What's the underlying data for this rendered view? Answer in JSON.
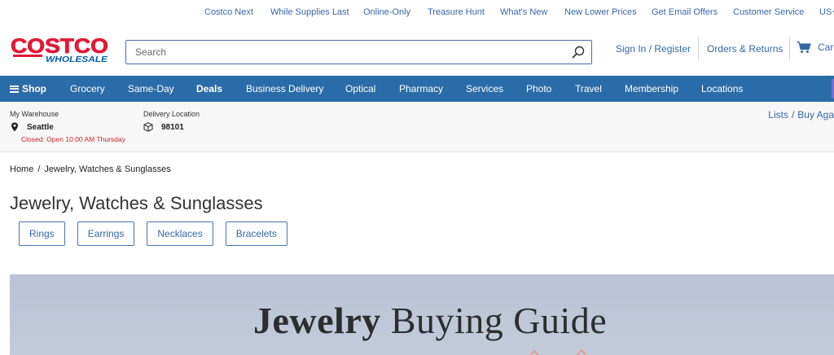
{
  "utility": {
    "links": [
      "Costco Next",
      "While Supplies Last",
      "Online-Only",
      "Treasure Hunt",
      "What's New",
      "New Lower Prices",
      "Get Email Offers",
      "Customer Service"
    ],
    "country": "US"
  },
  "header": {
    "logo_primary": "COSTCO",
    "logo_secondary": "WHOLESALE",
    "search_placeholder": "Search",
    "sign_in": "Sign In / Register",
    "orders": "Orders & Returns",
    "cart": "Car"
  },
  "nav": {
    "shop": "Shop",
    "items": [
      "Grocery",
      "Same-Day",
      "Deals",
      "Business Delivery",
      "Optical",
      "Pharmacy",
      "Services",
      "Photo",
      "Travel",
      "Membership",
      "Locations"
    ]
  },
  "location": {
    "warehouse_label": "My Warehouse",
    "warehouse_value": "Seattle",
    "warehouse_status": "Closed: Open 10:00 AM Thursday",
    "delivery_label": "Delivery Location",
    "delivery_value": "98101",
    "lists": "Lists",
    "separator": "/",
    "buy_again": "Buy Aga"
  },
  "breadcrumb": {
    "home": "Home",
    "separator": "/",
    "current": "Jewelry, Watches & Sunglasses"
  },
  "page": {
    "title": "Jewelry, Watches & Sunglasses"
  },
  "chips": [
    "Rings",
    "Earrings",
    "Necklaces",
    "Bracelets"
  ],
  "banner": {
    "title_strong": "Jewelry",
    "title_rest": " Buying Guide"
  },
  "colors": {
    "brand_red": "#e31837",
    "brand_blue": "#005daa",
    "link_blue": "#3668a6",
    "status_red": "#c8262e"
  }
}
